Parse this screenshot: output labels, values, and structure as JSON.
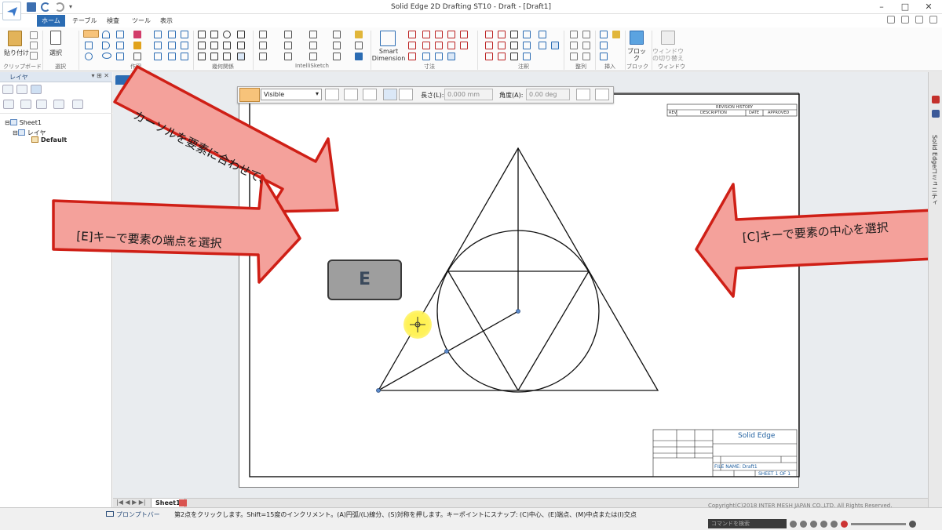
{
  "window": {
    "title": "Solid Edge 2D Drafting ST10 - Draft - [Draft1]"
  },
  "ribbon": {
    "tabs": [
      "ホーム",
      "テーブル",
      "検査",
      "ツール",
      "表示"
    ],
    "active_tab": "ホーム",
    "paste_label": "貼り付け",
    "select_label": "選択",
    "smart_dimension_label": "Smart Dimension",
    "block_label": "ブロック",
    "window_switch_label": "ウィンドウ の切り替え",
    "groups": [
      "クリップボード",
      "選択",
      "作図",
      "幾何関係",
      "IntelliSketch",
      "寸法",
      "注釈",
      "整列",
      "挿入",
      "ブロック",
      "ウィンドウ"
    ]
  },
  "layer_panel": {
    "title": "レイヤ",
    "tree": [
      {
        "label": "Sheet1",
        "level": 0
      },
      {
        "label": "レイヤ",
        "level": 1
      },
      {
        "label": "Default",
        "level": 2
      }
    ]
  },
  "command_bar": {
    "line_style": "Visible",
    "length_label": "長さ(L):",
    "length_value": "0.000 mm",
    "angle_label": "角度(A):",
    "angle_value": "0.00 deg"
  },
  "callouts": {
    "top": "カーソルを要素に合わせて、",
    "left": "[E]キーで要素の端点を選択",
    "right": "[C]キーで要素の中心を選択",
    "key": "E"
  },
  "title_block": {
    "revision_history": "REVISION HISTORY",
    "rev_cols": [
      "REV",
      "DESCRIPTION",
      "DATE",
      "APPROVED"
    ],
    "brand": "Solid Edge",
    "file_name": "FILE NAME: Draft1",
    "sheet": "SHEET 1 OF 1"
  },
  "sheet_tabs": [
    "Sheet1"
  ],
  "status": {
    "prompt_label": "プロンプトバー",
    "prompt_text": "第2点をクリックします。Shift=15度のインクリメント。(A)円弧/(L)線分、(S)対称を押します。キーポイントにスナップ: (C)中心、(E)端点、(M)中点または(I)交点",
    "copyright": "Copyright(C)2018 INTER MESH JAPAN CO.,LTD. All Rights Reserved.",
    "command_search": "コマンドを検索"
  },
  "right_sidebar": {
    "community": "Solid Edgeコミュニティ"
  },
  "colors": {
    "accent": "#2b6cb3",
    "callout_fill": "#f4a19b",
    "callout_border": "#cf1f16"
  }
}
